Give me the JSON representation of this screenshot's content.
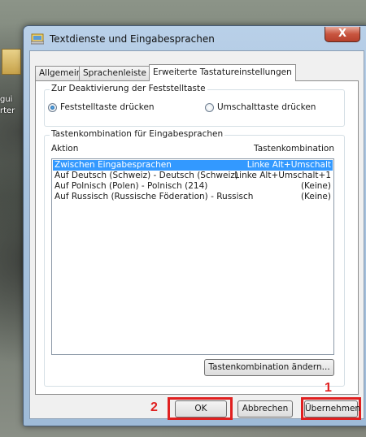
{
  "window": {
    "title": "Textdienste und Eingabesprachen",
    "close_symbol": "X"
  },
  "desktop": {
    "labels": [
      "gui",
      "rter"
    ]
  },
  "tabs": [
    {
      "label": "Allgemein"
    },
    {
      "label": "Sprachenleiste"
    },
    {
      "label": "Erweiterte Tastatureinstellungen",
      "active": true
    }
  ],
  "capslock": {
    "legend": "Zur Deaktivierung der Feststelltaste",
    "options": [
      {
        "label": "Feststelltaste drücken",
        "checked": true
      },
      {
        "label": "Umschalttaste drücken",
        "checked": false
      }
    ]
  },
  "hotkeys": {
    "legend": "Tastenkombination für Eingabesprachen",
    "col_action": "Aktion",
    "col_combo": "Tastenkombination",
    "rows": [
      {
        "action": "Zwischen Eingabesprachen",
        "combo": "Linke Alt+Umschalt",
        "selected": true
      },
      {
        "action": "Auf Deutsch (Schweiz) - Deutsch (Schweiz)",
        "combo": "Linke Alt+Umschalt+1"
      },
      {
        "action": "Auf Polnisch (Polen) - Polnisch (214)",
        "combo": "(Keine)"
      },
      {
        "action": "Auf Russisch (Russische Föderation) - Russisch",
        "combo": "(Keine)"
      }
    ],
    "change_button": "Tastenkombination ändern..."
  },
  "footer": {
    "ok": "OK",
    "cancel": "Abbrechen",
    "apply": "Übernehmen"
  },
  "annotations": {
    "marker_1": "1",
    "marker_2": "2",
    "color": "#e02020"
  }
}
